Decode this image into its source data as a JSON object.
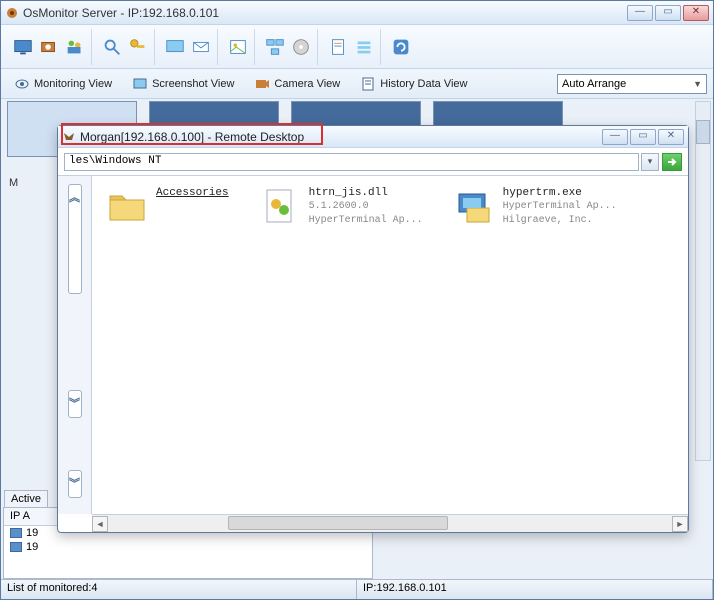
{
  "main": {
    "title": "OsMonitor Server -  IP:192.168.0.101"
  },
  "viewbar": {
    "monitoring": "Monitoring View",
    "screenshot": "Screenshot View",
    "camera": "Camera View",
    "history": "History Data View",
    "dropdown": "Auto Arrange"
  },
  "thumbs": {
    "label": "M"
  },
  "subwindow": {
    "title": "Morgan[192.168.0.100] - Remote Desktop",
    "path": "les\\Windows NT",
    "items": {
      "folder": {
        "name": "Accessories"
      },
      "dll": {
        "name": "htrn_jis.dll",
        "ver": "5.1.2600.0",
        "desc": "HyperTerminal Ap..."
      },
      "exe": {
        "name": "hypertrm.exe",
        "desc": "HyperTerminal Ap...",
        "vendor": "Hilgraeve, Inc."
      }
    }
  },
  "bottom": {
    "tab": "Active",
    "col": "IP A",
    "row1": "19",
    "row2": "19"
  },
  "status": {
    "left": "List of monitored:4",
    "right": "IP:192.168.0.101"
  }
}
